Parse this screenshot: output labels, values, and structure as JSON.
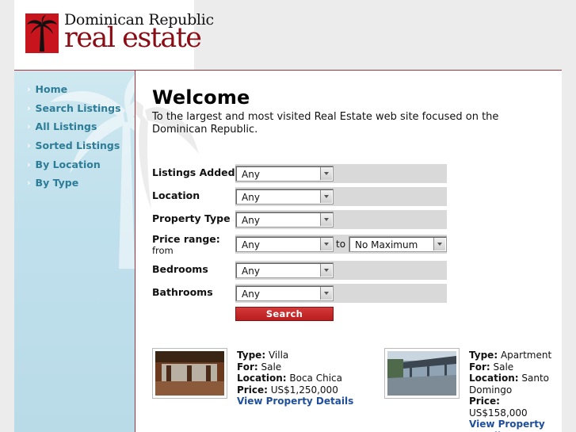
{
  "brand": {
    "line1": "Dominican Republic",
    "line2": "real estate"
  },
  "nav": [
    {
      "label": "Home"
    },
    {
      "label": "Search Listings"
    },
    {
      "label": "All Listings"
    },
    {
      "label": "Sorted Listings"
    },
    {
      "label": "By Location"
    },
    {
      "label": "By Type"
    }
  ],
  "main": {
    "title": "Welcome",
    "subtitle": "To the largest and most visited Real Estate web site focused on the Dominican Republic."
  },
  "search": {
    "listings_added": {
      "label": "Listings Added",
      "value": "Any"
    },
    "location": {
      "label": "Location",
      "value": "Any"
    },
    "property_type": {
      "label": "Property Type",
      "value": "Any"
    },
    "price_range": {
      "label": "Price range:",
      "sublabel": "from",
      "from_value": "Any",
      "to_label": "to",
      "to_value": "No Maximum"
    },
    "bedrooms": {
      "label": "Bedrooms",
      "value": "Any"
    },
    "bathrooms": {
      "label": "Bathrooms",
      "value": "Any"
    },
    "button_label": "Search"
  },
  "listings": [
    {
      "type_label": "Type:",
      "type": "Villa",
      "for_label": "For:",
      "for": "Sale",
      "location_label": "Location:",
      "location": "Boca Chica",
      "price_label": "Price:",
      "price": "US$1,250,000",
      "link": "View Property Details"
    },
    {
      "type_label": "Type:",
      "type": "Apartment",
      "for_label": "For:",
      "for": "Sale",
      "location_label": "Location:",
      "location": "Santo Domingo",
      "price_label": "Price:",
      "price": "US$158,000",
      "link": "View Property Details"
    }
  ],
  "icons": {
    "nav_bullet": "chevron-right-icon",
    "logo": "palm-tree-logo-icon"
  },
  "colors": {
    "accent": "#8b0c14",
    "nav_text": "#2d7d98",
    "link": "#1f4f9a",
    "button": "#c42a2a"
  }
}
